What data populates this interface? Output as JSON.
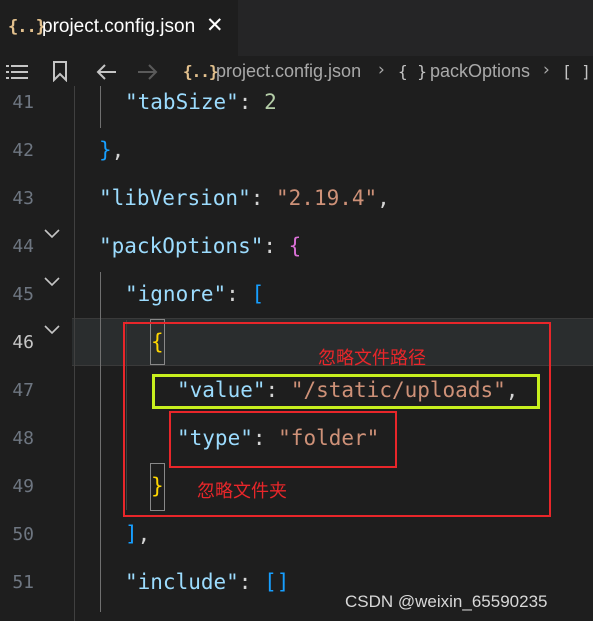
{
  "tab": {
    "icon": "{..}",
    "title": "project.config.json",
    "close": "✕"
  },
  "breadcrumbs": {
    "file_icon": "{..}",
    "file": "project.config.json",
    "obj_icon": "{ }",
    "key": "packOptions",
    "arr_icon": "[ ]"
  },
  "editor": {
    "active_line": 46,
    "line_numbers": [
      "41",
      "42",
      "43",
      "44",
      "45",
      "46",
      "47",
      "48",
      "49",
      "50",
      "51"
    ],
    "lines": {
      "l41": {
        "key": "\"tabSize\"",
        "colon": ": ",
        "num": "2"
      },
      "l42": {
        "brace": "}",
        "comma": ","
      },
      "l43": {
        "key": "\"libVersion\"",
        "colon": ": ",
        "str": "\"2.19.4\"",
        "comma": ","
      },
      "l44": {
        "key": "\"packOptions\"",
        "colon": ": ",
        "brace": "{"
      },
      "l45": {
        "key": "\"ignore\"",
        "colon": ": ",
        "bracket": "["
      },
      "l46": {
        "brace": "{"
      },
      "l47": {
        "key": "\"value\"",
        "colon": ": ",
        "str": "\"/static/uploads\"",
        "comma": ","
      },
      "l48": {
        "key": "\"type\"",
        "colon": ": ",
        "str": "\"folder\""
      },
      "l49": {
        "brace": "}"
      },
      "l50": {
        "bracket": "]",
        "comma": ","
      },
      "l51": {
        "key": "\"include\"",
        "colon": ": ",
        "bracket": "[]"
      }
    }
  },
  "annotations": {
    "path_label": "忽略文件路径",
    "folder_label": "忽略文件夹",
    "colors": {
      "red": "#e8262a",
      "green": "#c8f01e"
    }
  },
  "watermark": "CSDN @weixin_65590235"
}
